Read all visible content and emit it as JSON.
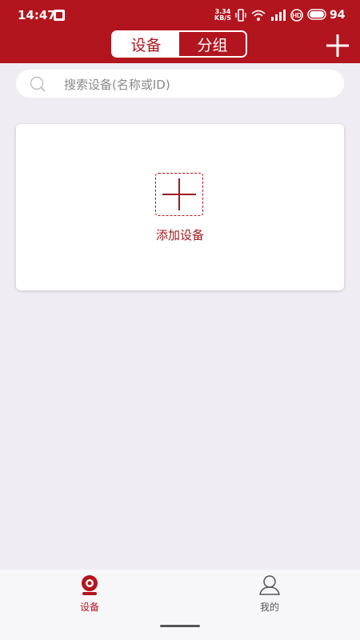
{
  "status_bar": {
    "time": "14:47",
    "net_speed_value": "3.34",
    "net_speed_unit": "KB/S",
    "battery": "94"
  },
  "header": {
    "tabs": [
      {
        "label": "设备",
        "active": true
      },
      {
        "label": "分组",
        "active": false
      }
    ],
    "add_icon": "plus-icon"
  },
  "search": {
    "placeholder": "搜索设备(名称或ID)",
    "icon": "search-icon"
  },
  "card": {
    "add_label": "添加设备",
    "icon": "plus-icon"
  },
  "bottom_nav": {
    "items": [
      {
        "label": "设备",
        "icon": "camera-icon",
        "active": true
      },
      {
        "label": "我的",
        "icon": "person-icon",
        "active": false
      }
    ]
  },
  "colors": {
    "brand": "#b3151e",
    "background": "#efedf3"
  }
}
